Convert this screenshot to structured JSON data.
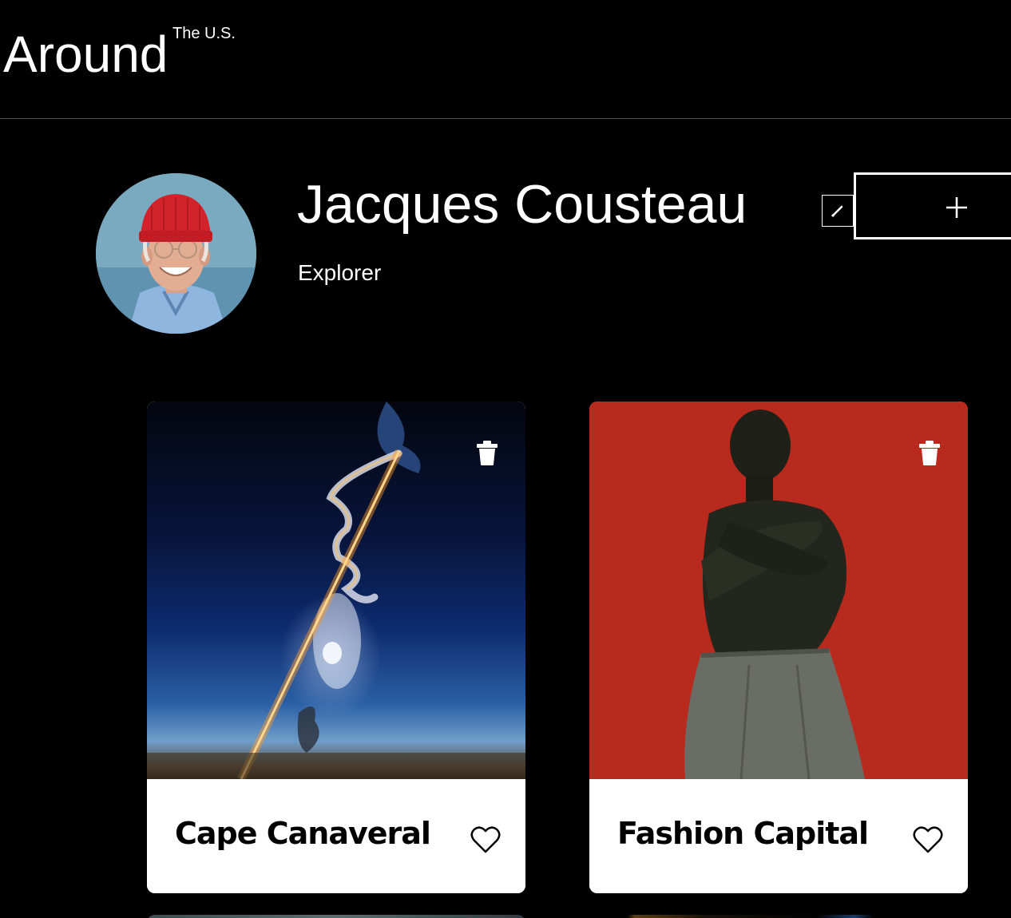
{
  "header": {
    "logo_main": "Around",
    "logo_sup": "The U.S."
  },
  "profile": {
    "name": "Jacques Cousteau",
    "about": "Explorer",
    "edit_icon": "pencil-icon",
    "add_icon": "plus-icon"
  },
  "cards": [
    {
      "title": "Cape Canaveral",
      "delete_icon": "trash-icon",
      "like_icon": "heart-icon"
    },
    {
      "title": "Fashion Capital",
      "delete_icon": "trash-icon",
      "like_icon": "heart-icon"
    }
  ],
  "colors": {
    "background": "#000000",
    "card_footer": "#ffffff",
    "card2_image": "#b82a1d"
  }
}
